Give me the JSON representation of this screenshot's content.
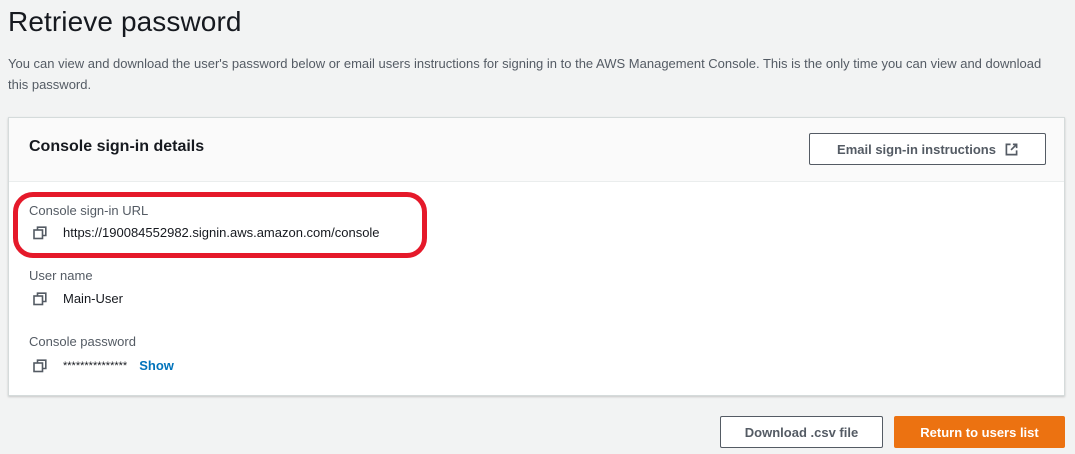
{
  "page": {
    "title": "Retrieve password",
    "description": "You can view and download the user's password below or email users instructions for signing in to the AWS Management Console. This is the only time you can view and download this password."
  },
  "card": {
    "title": "Console sign-in details",
    "email_button_label": "Email sign-in instructions",
    "fields": {
      "url": {
        "label": "Console sign-in URL",
        "value": "https://190084552982.signin.aws.amazon.com/console"
      },
      "username": {
        "label": "User name",
        "value": "Main-User"
      },
      "password": {
        "label": "Console password",
        "value": "***************",
        "show_label": "Show"
      }
    }
  },
  "footer": {
    "download_label": "Download .csv file",
    "return_label": "Return to users list"
  },
  "colors": {
    "primary_button": "#ec7211",
    "link": "#0073bb",
    "highlight": "#e5192a"
  },
  "icons": {
    "copy": "copy-icon",
    "external": "external-link-icon"
  }
}
